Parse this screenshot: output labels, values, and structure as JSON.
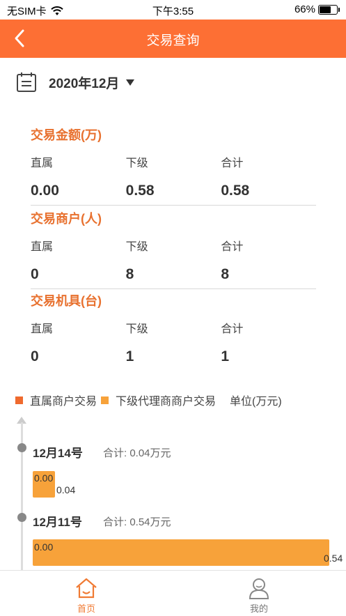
{
  "status_bar": {
    "carrier": "无SIM卡",
    "time": "下午3:55",
    "battery": "66%",
    "battery_level": 0.66
  },
  "nav": {
    "title": "交易查询",
    "back_icon": "chevron-left-icon"
  },
  "date_filter": {
    "icon": "calendar-icon",
    "value": "2020年12月"
  },
  "sections": [
    {
      "title": "交易金额(万)",
      "labels": [
        "直属",
        "下级",
        "合计"
      ],
      "values": [
        "0.00",
        "0.58",
        "0.58"
      ]
    },
    {
      "title": "交易商户(人)",
      "labels": [
        "直属",
        "下级",
        "合计"
      ],
      "values": [
        "0",
        "8",
        "8"
      ]
    },
    {
      "title": "交易机具(台)",
      "labels": [
        "直属",
        "下级",
        "合计"
      ],
      "values": [
        "0",
        "1",
        "1"
      ]
    }
  ],
  "legend": {
    "direct": "直属商户交易",
    "sub": "下级代理商商户交易",
    "unit": "单位(万元)",
    "direct_color": "#ef6a2e",
    "sub_color": "#f7a23a"
  },
  "timeline": [
    {
      "day": "12月14号",
      "total": "合计: 0.04万元",
      "direct": "0.00",
      "sub": "0.04",
      "sub_value": 0.04
    },
    {
      "day": "12月11号",
      "total": "合计: 0.54万元",
      "direct": "0.00",
      "sub": "0.54",
      "sub_value": 0.54
    }
  ],
  "tabs": [
    {
      "label": "首页",
      "icon": "home-icon",
      "active": true
    },
    {
      "label": "我的",
      "icon": "user-icon",
      "active": false
    }
  ],
  "colors": {
    "accent": "#fd6f34",
    "section_title": "#e8712f"
  }
}
